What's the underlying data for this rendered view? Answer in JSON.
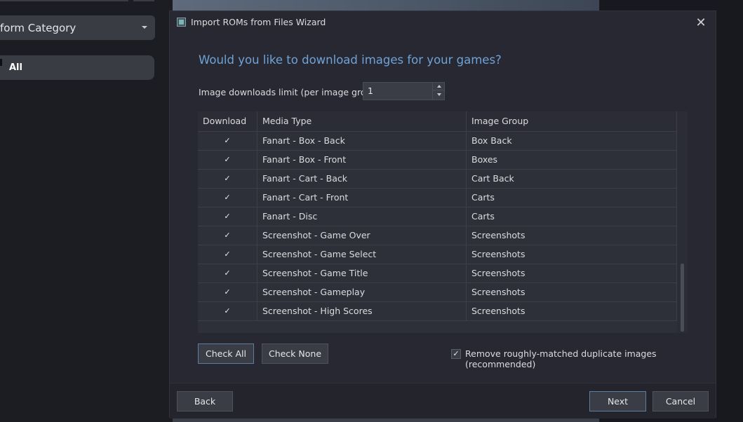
{
  "background": {
    "category_dropdown": "Platform Category",
    "category_dropdown_visible": "form Category",
    "all_item": "All"
  },
  "dialog": {
    "title": "Import ROMs from Files Wizard",
    "close_glyph": "✕",
    "heading": "Would you like to download images for your games?",
    "limit_label": "Image downloads limit (per image group):",
    "limit_value": "1",
    "table": {
      "columns": [
        "Download",
        "Media Type",
        "Image Group"
      ],
      "rows": [
        {
          "checked": true,
          "media_type": "Fanart - Box - Back",
          "image_group": "Box Back"
        },
        {
          "checked": true,
          "media_type": "Fanart - Box - Front",
          "image_group": "Boxes"
        },
        {
          "checked": true,
          "media_type": "Fanart - Cart - Back",
          "image_group": "Cart Back"
        },
        {
          "checked": true,
          "media_type": "Fanart - Cart - Front",
          "image_group": "Carts"
        },
        {
          "checked": true,
          "media_type": "Fanart - Disc",
          "image_group": "Carts"
        },
        {
          "checked": true,
          "media_type": "Screenshot - Game Over",
          "image_group": "Screenshots"
        },
        {
          "checked": true,
          "media_type": "Screenshot - Game Select",
          "image_group": "Screenshots"
        },
        {
          "checked": true,
          "media_type": "Screenshot - Game Title",
          "image_group": "Screenshots"
        },
        {
          "checked": true,
          "media_type": "Screenshot - Gameplay",
          "image_group": "Screenshots"
        },
        {
          "checked": true,
          "media_type": "Screenshot - High Scores",
          "image_group": "Screenshots"
        }
      ]
    },
    "check_all_label": "Check All",
    "check_none_label": "Check None",
    "dedupe_checked": true,
    "dedupe_label": "Remove roughly-matched duplicate images (recommended)",
    "back_label": "Back",
    "next_label": "Next",
    "cancel_label": "Cancel",
    "check_glyph": "✓"
  },
  "colors": {
    "heading": "#6fa3d8",
    "dialog_bg": "#272831",
    "table_bg": "#2e3039",
    "button_bg": "#3b3d46"
  },
  "icons": {
    "app": "app-icon",
    "close": "close-icon",
    "check": "checkmark-icon",
    "spin_up": "chevron-up-icon",
    "spin_down": "chevron-down-icon",
    "dropdown": "chevron-down-icon"
  }
}
